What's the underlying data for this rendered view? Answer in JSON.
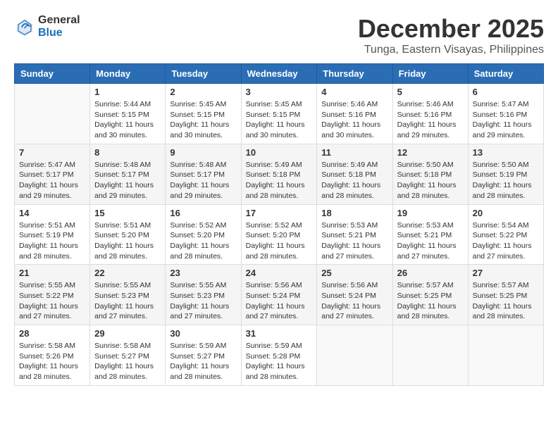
{
  "header": {
    "logo_general": "General",
    "logo_blue": "Blue",
    "month": "December 2025",
    "location": "Tunga, Eastern Visayas, Philippines"
  },
  "weekdays": [
    "Sunday",
    "Monday",
    "Tuesday",
    "Wednesday",
    "Thursday",
    "Friday",
    "Saturday"
  ],
  "weeks": [
    [
      {
        "day": "",
        "content": ""
      },
      {
        "day": "1",
        "content": "Sunrise: 5:44 AM\nSunset: 5:15 PM\nDaylight: 11 hours and 30 minutes."
      },
      {
        "day": "2",
        "content": "Sunrise: 5:45 AM\nSunset: 5:15 PM\nDaylight: 11 hours and 30 minutes."
      },
      {
        "day": "3",
        "content": "Sunrise: 5:45 AM\nSunset: 5:15 PM\nDaylight: 11 hours and 30 minutes."
      },
      {
        "day": "4",
        "content": "Sunrise: 5:46 AM\nSunset: 5:16 PM\nDaylight: 11 hours and 30 minutes."
      },
      {
        "day": "5",
        "content": "Sunrise: 5:46 AM\nSunset: 5:16 PM\nDaylight: 11 hours and 29 minutes."
      },
      {
        "day": "6",
        "content": "Sunrise: 5:47 AM\nSunset: 5:16 PM\nDaylight: 11 hours and 29 minutes."
      }
    ],
    [
      {
        "day": "7",
        "content": "Sunrise: 5:47 AM\nSunset: 5:17 PM\nDaylight: 11 hours and 29 minutes."
      },
      {
        "day": "8",
        "content": "Sunrise: 5:48 AM\nSunset: 5:17 PM\nDaylight: 11 hours and 29 minutes."
      },
      {
        "day": "9",
        "content": "Sunrise: 5:48 AM\nSunset: 5:17 PM\nDaylight: 11 hours and 29 minutes."
      },
      {
        "day": "10",
        "content": "Sunrise: 5:49 AM\nSunset: 5:18 PM\nDaylight: 11 hours and 28 minutes."
      },
      {
        "day": "11",
        "content": "Sunrise: 5:49 AM\nSunset: 5:18 PM\nDaylight: 11 hours and 28 minutes."
      },
      {
        "day": "12",
        "content": "Sunrise: 5:50 AM\nSunset: 5:18 PM\nDaylight: 11 hours and 28 minutes."
      },
      {
        "day": "13",
        "content": "Sunrise: 5:50 AM\nSunset: 5:19 PM\nDaylight: 11 hours and 28 minutes."
      }
    ],
    [
      {
        "day": "14",
        "content": "Sunrise: 5:51 AM\nSunset: 5:19 PM\nDaylight: 11 hours and 28 minutes."
      },
      {
        "day": "15",
        "content": "Sunrise: 5:51 AM\nSunset: 5:20 PM\nDaylight: 11 hours and 28 minutes."
      },
      {
        "day": "16",
        "content": "Sunrise: 5:52 AM\nSunset: 5:20 PM\nDaylight: 11 hours and 28 minutes."
      },
      {
        "day": "17",
        "content": "Sunrise: 5:52 AM\nSunset: 5:20 PM\nDaylight: 11 hours and 28 minutes."
      },
      {
        "day": "18",
        "content": "Sunrise: 5:53 AM\nSunset: 5:21 PM\nDaylight: 11 hours and 27 minutes."
      },
      {
        "day": "19",
        "content": "Sunrise: 5:53 AM\nSunset: 5:21 PM\nDaylight: 11 hours and 27 minutes."
      },
      {
        "day": "20",
        "content": "Sunrise: 5:54 AM\nSunset: 5:22 PM\nDaylight: 11 hours and 27 minutes."
      }
    ],
    [
      {
        "day": "21",
        "content": "Sunrise: 5:55 AM\nSunset: 5:22 PM\nDaylight: 11 hours and 27 minutes."
      },
      {
        "day": "22",
        "content": "Sunrise: 5:55 AM\nSunset: 5:23 PM\nDaylight: 11 hours and 27 minutes."
      },
      {
        "day": "23",
        "content": "Sunrise: 5:55 AM\nSunset: 5:23 PM\nDaylight: 11 hours and 27 minutes."
      },
      {
        "day": "24",
        "content": "Sunrise: 5:56 AM\nSunset: 5:24 PM\nDaylight: 11 hours and 27 minutes."
      },
      {
        "day": "25",
        "content": "Sunrise: 5:56 AM\nSunset: 5:24 PM\nDaylight: 11 hours and 27 minutes."
      },
      {
        "day": "26",
        "content": "Sunrise: 5:57 AM\nSunset: 5:25 PM\nDaylight: 11 hours and 28 minutes."
      },
      {
        "day": "27",
        "content": "Sunrise: 5:57 AM\nSunset: 5:25 PM\nDaylight: 11 hours and 28 minutes."
      }
    ],
    [
      {
        "day": "28",
        "content": "Sunrise: 5:58 AM\nSunset: 5:26 PM\nDaylight: 11 hours and 28 minutes."
      },
      {
        "day": "29",
        "content": "Sunrise: 5:58 AM\nSunset: 5:27 PM\nDaylight: 11 hours and 28 minutes."
      },
      {
        "day": "30",
        "content": "Sunrise: 5:59 AM\nSunset: 5:27 PM\nDaylight: 11 hours and 28 minutes."
      },
      {
        "day": "31",
        "content": "Sunrise: 5:59 AM\nSunset: 5:28 PM\nDaylight: 11 hours and 28 minutes."
      },
      {
        "day": "",
        "content": ""
      },
      {
        "day": "",
        "content": ""
      },
      {
        "day": "",
        "content": ""
      }
    ]
  ]
}
